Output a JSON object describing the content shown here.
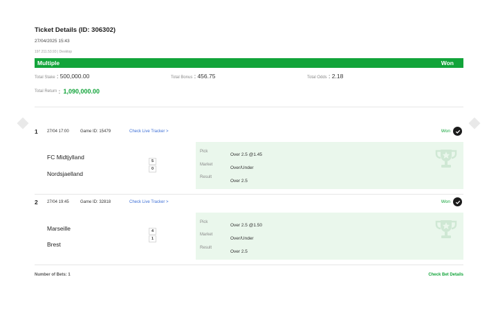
{
  "ticket": {
    "title": "Ticket Details (ID: 306302)",
    "date": "27/04/2025 15:43",
    "ip": "197.211.53.93 | Desktop",
    "bet_type": "Multiple",
    "status": "Won"
  },
  "totals": {
    "stake_label": "Total Stake",
    "stake_value": "500,000.00",
    "bonus_label": "Total Bonus",
    "bonus_value": "456.75",
    "odds_label": "Total Odds",
    "odds_value": "2.18",
    "return_label": "Total Return",
    "return_value": "1,090,000.00"
  },
  "bets": [
    {
      "number": "1",
      "time": "27/04 17:00",
      "game_id": "Game ID: 15479",
      "tracker": "Check Live Tracker >",
      "status": "Won",
      "home_team": "FC Midtjylland",
      "away_team": "Nordsjaelland",
      "home_score": "5",
      "away_score": "0",
      "pick_label": "Pick",
      "pick_value": "Over 2.5 @1.45",
      "market_label": "Market",
      "market_value": "Over/Under",
      "result_label": "Result",
      "result_value": "Over 2.5"
    },
    {
      "number": "2",
      "time": "27/04 19:45",
      "game_id": "Game ID: 32818",
      "tracker": "Check Live Tracker >",
      "status": "Won",
      "home_team": "Marseille",
      "away_team": "Brest",
      "home_score": "4",
      "away_score": "1",
      "pick_label": "Pick",
      "pick_value": "Over 2.5 @1.50",
      "market_label": "Market",
      "market_value": "Over/Under",
      "result_label": "Result",
      "result_value": "Over 2.5"
    }
  ],
  "footer": {
    "bets_count": "Number of Bets: 1",
    "check_details": "Check Bet Details"
  },
  "colors": {
    "accent": "#12a43a",
    "link": "#3d6fd6",
    "pick_bg": "#eaf7ec"
  }
}
